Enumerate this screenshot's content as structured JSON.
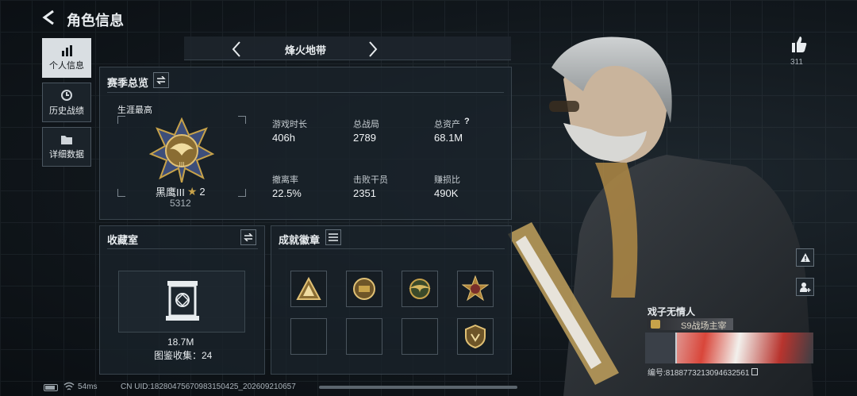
{
  "header": {
    "title": "角色信息"
  },
  "sidebar": {
    "items": [
      {
        "label": "个人信息",
        "icon": "bar-chart-icon",
        "active": true
      },
      {
        "label": "历史战绩",
        "icon": "clock-icon",
        "active": false
      },
      {
        "label": "详细数据",
        "icon": "folder-icon",
        "active": false
      }
    ]
  },
  "mode_selector": {
    "label": "烽火地带"
  },
  "season": {
    "title": "赛季总览",
    "career_label": "生涯最高",
    "rank_name": "黑鹰III",
    "rank_stars": "2",
    "rank_points": "5312",
    "stats": [
      {
        "label": "游戏时长",
        "value": "406h"
      },
      {
        "label": "总战局",
        "value": "2789"
      },
      {
        "label": "总资产",
        "value": "68.1M"
      },
      {
        "label": "撤离率",
        "value": "22.5%"
      },
      {
        "label": "击败干员",
        "value": "2351"
      },
      {
        "label": "赚损比",
        "value": "490K"
      }
    ],
    "help": "?"
  },
  "collection": {
    "title": "收藏室",
    "value": "18.7M",
    "count_text": "图鉴收集：24"
  },
  "achievements": {
    "title": "成就徽章"
  },
  "likes": {
    "count": "311"
  },
  "player": {
    "name": "戏子无情人",
    "title_badge": "S9战场主宰",
    "id_text": "编号:8188773213094632561"
  },
  "status": {
    "ping": "54ms",
    "uid": "CN UID:18280475670983150425_202609210657"
  },
  "colors": {
    "accent_gold": "#c7a24a",
    "panel_border": "#39444d"
  }
}
